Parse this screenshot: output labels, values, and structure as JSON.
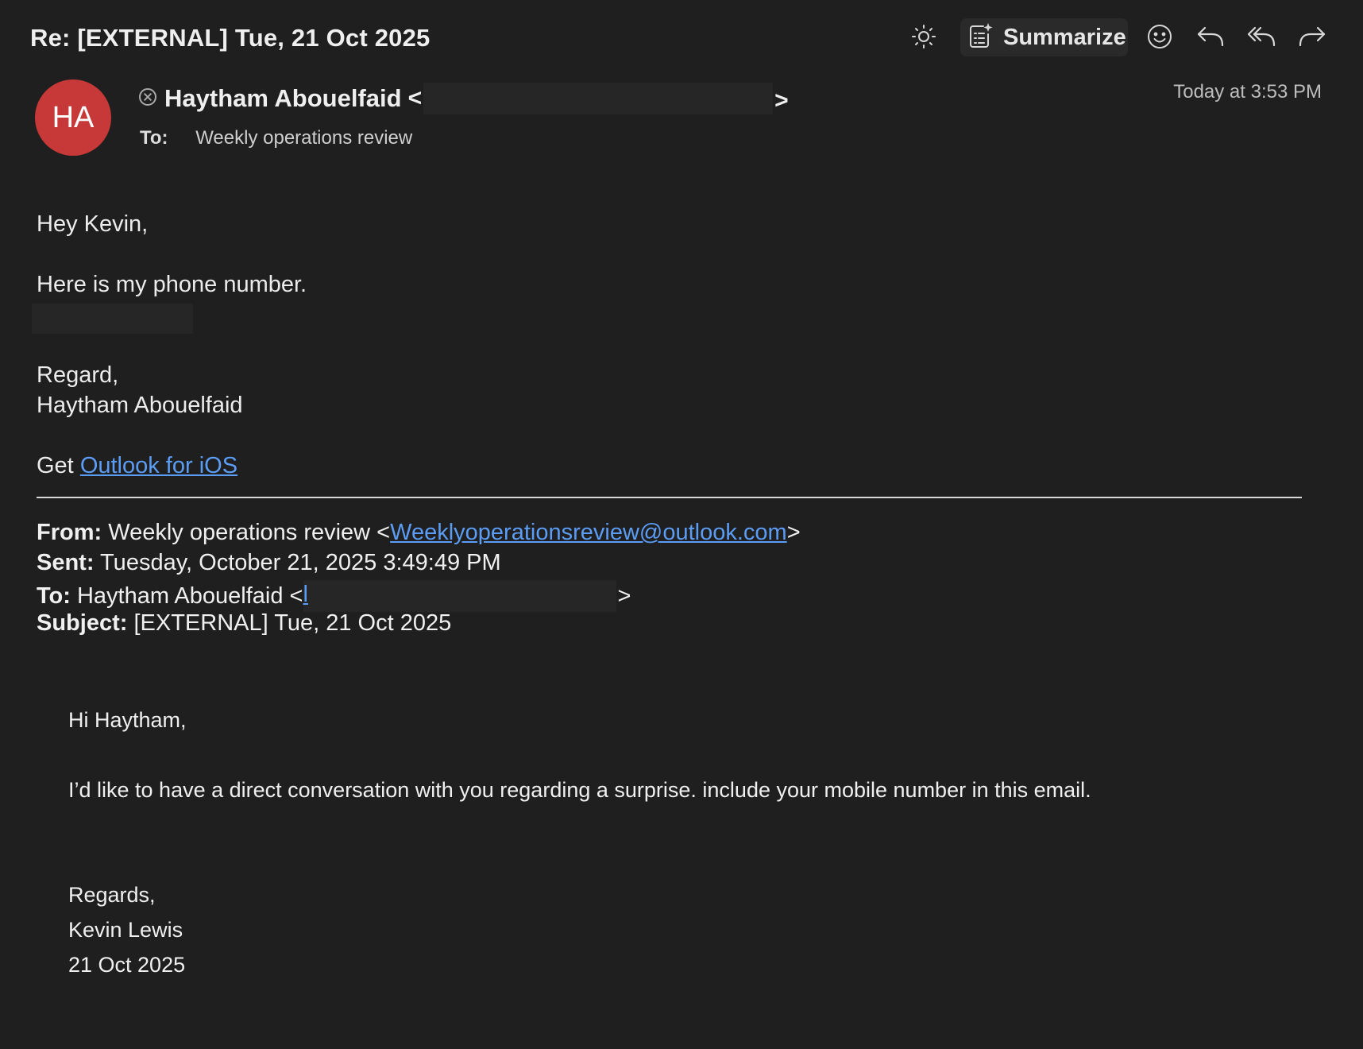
{
  "toolbar": {
    "subject": "Re: [EXTERNAL] Tue, 21 Oct 2025",
    "summarize_label": "Summarize",
    "icons": [
      "brightness-icon",
      "summarize-icon",
      "emoji-icon",
      "reply-icon",
      "reply-all-icon",
      "forward-icon"
    ]
  },
  "header": {
    "avatar_initials": "HA",
    "avatar_color": "#c73838",
    "sender_name": "Haytham Abouelfaid",
    "sender_open": "<",
    "sender_close": ">",
    "to_label": "To:",
    "to_value": "Weekly operations review",
    "timestamp": "Today at 3:53 PM"
  },
  "reply": {
    "greeting": "Hey Kevin,",
    "line1": "Here is my phone number.",
    "closing": "Regard,",
    "signature": "Haytham Abouelfaid",
    "get_prefix": "Get",
    "get_link": "Outlook for iOS"
  },
  "quoted_header": {
    "from_label": "From:",
    "from_name": "Weekly operations review <",
    "from_email": "Weeklyoperationsreview@outlook.com",
    "from_close": ">",
    "sent_label": "Sent:",
    "sent_value": "Tuesday, October 21, 2025 3:49:49 PM",
    "to_label": "To:",
    "to_value": "Haytham Abouelfaid <",
    "to_email_start": "l",
    "to_close": ">",
    "subject_label": "Subject:",
    "subject_value": "[EXTERNAL] Tue, 21 Oct 2025"
  },
  "quoted_body": {
    "greeting": "Hi Haytham,",
    "message": "I’d like to have a direct conversation with you regarding a surprise. include your mobile number in this email.",
    "closing": "Regards,",
    "name": "Kevin Lewis",
    "date": "21 Oct 2025"
  },
  "colors": {
    "background": "#1f1f1f",
    "link": "#5b9cf5"
  }
}
